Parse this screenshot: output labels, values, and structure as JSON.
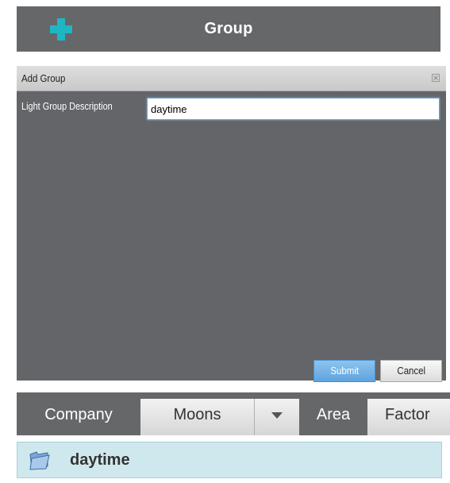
{
  "topbar": {
    "title": "Group",
    "icon": "plus-icon",
    "accent_color": "#1fb6c4"
  },
  "dialog": {
    "title": "Add Group",
    "close_icon": "close-icon",
    "field_label": "Light Group Description",
    "field_value": "daytime",
    "submit_label": "Submit",
    "cancel_label": "Cancel"
  },
  "tabs": [
    {
      "label": "Company",
      "active": false
    },
    {
      "label": "Moons",
      "active": true
    },
    {
      "label": "",
      "icon": "chevron-down-icon"
    },
    {
      "label": "Area",
      "active": false
    },
    {
      "label": "Factor",
      "active": true
    }
  ],
  "list": {
    "items": [
      {
        "label": "daytime",
        "icon": "folder-icon"
      }
    ]
  }
}
